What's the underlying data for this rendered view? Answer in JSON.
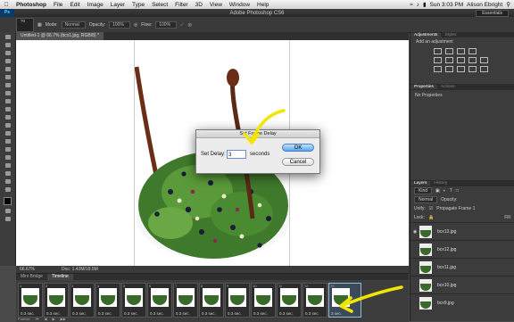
{
  "menubar": {
    "app": "Photoshop",
    "items": [
      "File",
      "Edit",
      "Image",
      "Layer",
      "Type",
      "Select",
      "Filter",
      "3D",
      "View",
      "Window",
      "Help"
    ],
    "clock": "Sun 3:03 PM",
    "user": "Alison Ebright"
  },
  "window": {
    "title": "Adobe Photoshop CS6",
    "workspace": "Essentials",
    "document_tab": "Untitled-1 @ 66.7% (bcx1.jpg, RGB/8) *"
  },
  "options_bar": {
    "brush_size": "70",
    "mode_label": "Mode:",
    "mode_value": "Normal",
    "opacity_label": "Opacity:",
    "opacity_value": "100%",
    "flow_label": "Flow:",
    "flow_value": "100%"
  },
  "status": {
    "zoom": "66.67%",
    "doc": "Doc: 1.42M/18.5M"
  },
  "timeline": {
    "tabs": [
      "Mini Bridge",
      "Timeline"
    ],
    "active_tab": "Timeline",
    "frames": [
      {
        "num": "1",
        "delay": "0.3 sec."
      },
      {
        "num": "2",
        "delay": "0.3 sec."
      },
      {
        "num": "3",
        "delay": "0.3 sec."
      },
      {
        "num": "4",
        "delay": "0.3 sec."
      },
      {
        "num": "5",
        "delay": "0.3 sec."
      },
      {
        "num": "6",
        "delay": "0.3 sec."
      },
      {
        "num": "7",
        "delay": "0.3 sec."
      },
      {
        "num": "8",
        "delay": "0.3 sec."
      },
      {
        "num": "9",
        "delay": "0.3 sec."
      },
      {
        "num": "10",
        "delay": "0.3 sec."
      },
      {
        "num": "11",
        "delay": "0.3 sec."
      },
      {
        "num": "12",
        "delay": "0.3 sec."
      },
      {
        "num": "13",
        "delay": "3 sec."
      }
    ],
    "selected_frame": 12,
    "controls": [
      "Forever"
    ]
  },
  "panels": {
    "adjustments_tabs": [
      "Adjustments",
      "Styles"
    ],
    "adjustments_sub": "Add an adjustment",
    "properties_tabs": [
      "Properties",
      "Actions"
    ],
    "properties_msg": "No Properties",
    "layers_tabs": [
      "Layers",
      "History"
    ],
    "layers_kind": "Kind",
    "blend_mode": "Normal",
    "opacity_label": "Opacity:",
    "unify_label": "Unify:",
    "propagate_label": "Propagate Frame 1",
    "lock_label": "Lock:",
    "fill_label": "Fill:",
    "layers": [
      "bcx13.jpg",
      "bcx12.jpg",
      "bcx11.jpg",
      "bcx10.jpg",
      "bcx9.jpg"
    ]
  },
  "dialog": {
    "title": "Set Frame Delay",
    "label": "Set Delay:",
    "value": "3",
    "unit": "seconds",
    "ok": "OK",
    "cancel": "Cancel"
  },
  "colors": {
    "annotation": "#f2e500",
    "ps_dark": "#3c3c3c",
    "ok_blue": "#5aa6ef"
  }
}
